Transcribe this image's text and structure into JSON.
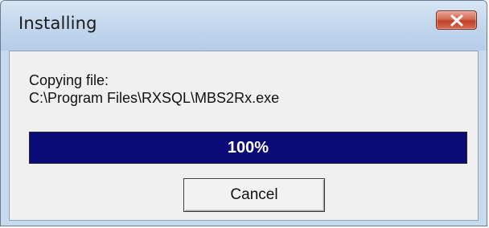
{
  "window": {
    "title": "Installing"
  },
  "titlebar": {
    "close_icon": "close-icon"
  },
  "status": {
    "label": "Copying file:",
    "path": "C:\\Program Files\\RXSQL\\MBS2Rx.exe"
  },
  "progress": {
    "value_percent": 100,
    "text": "100%",
    "fill_color": "#0a0a78"
  },
  "buttons": {
    "cancel_label": "Cancel"
  }
}
